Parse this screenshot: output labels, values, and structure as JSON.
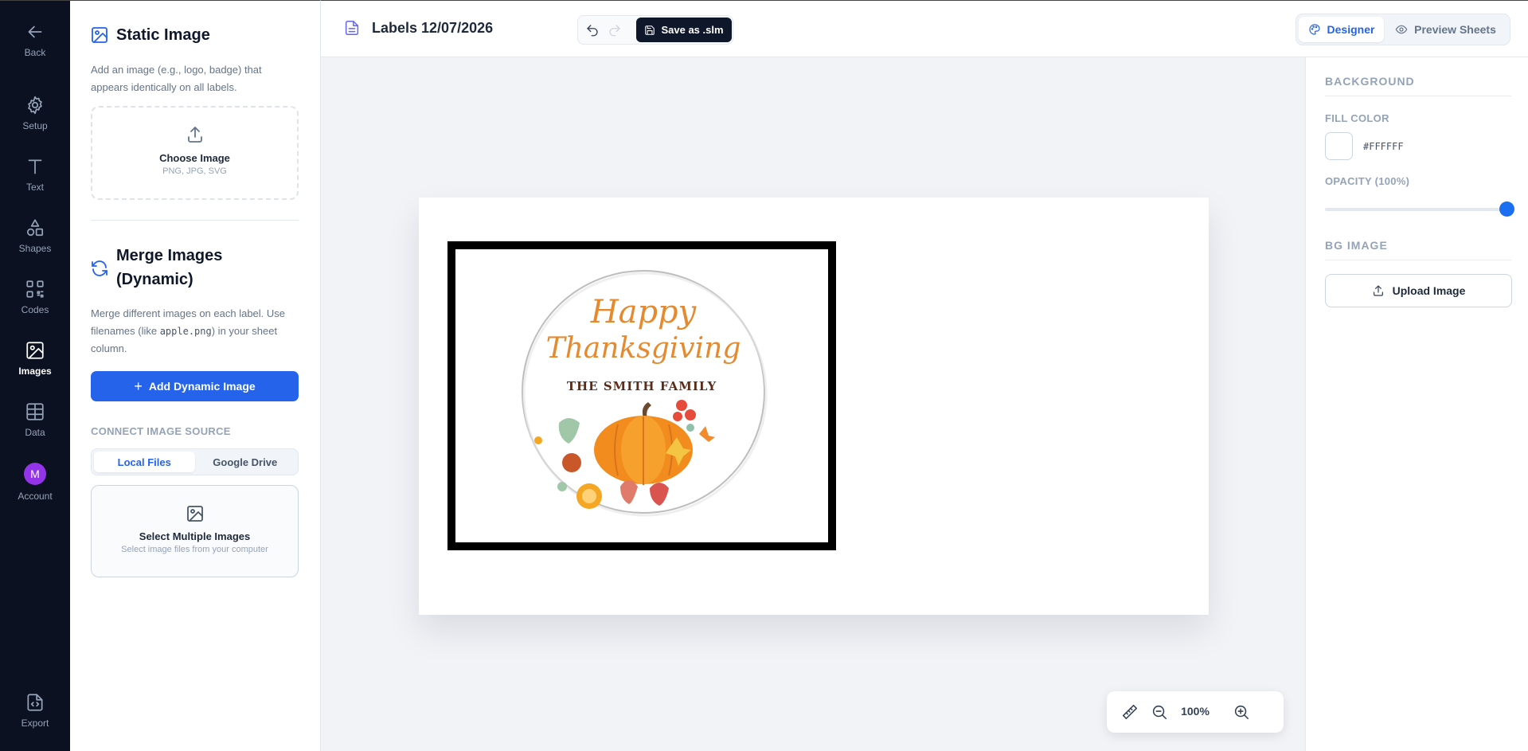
{
  "nav": {
    "back": "Back",
    "setup": "Setup",
    "text": "Text",
    "shapes": "Shapes",
    "codes": "Codes",
    "images": "Images",
    "data": "Data",
    "account": "Account",
    "account_initial": "M",
    "export": "Export"
  },
  "static_image": {
    "title": "Static Image",
    "description": "Add an image (e.g., logo, badge) that appears identically on all labels.",
    "choose_title": "Choose Image",
    "choose_sub": "PNG, JPG, SVG"
  },
  "merge_images": {
    "title": "Merge Images (Dynamic)",
    "desc_part1": "Merge different images on each label. Use filenames (like ",
    "desc_code": "apple.png",
    "desc_part2": ") in your sheet column.",
    "add_button": "Add Dynamic Image",
    "source_label": "CONNECT IMAGE SOURCE",
    "tabs": [
      "Local Files",
      "Google Drive"
    ],
    "active_tab": "Local Files",
    "select_title": "Select Multiple Images",
    "select_sub": "Select image files from your computer"
  },
  "header": {
    "doc_title": "Labels 12/07/2026",
    "save_label": "Save as .slm",
    "modes": [
      "Designer",
      "Preview Sheets"
    ],
    "active_mode": "Designer"
  },
  "canvas": {
    "artwork": {
      "line1": "Happy",
      "line2": "Thanksgiving",
      "line3": "THE SMITH FAMILY"
    },
    "zoom": "100%"
  },
  "properties": {
    "background_title": "BACKGROUND",
    "fill_color_label": "FILL COLOR",
    "fill_color_value": "#FFFFFF",
    "opacity_label": "OPACITY (100%)",
    "opacity_value": 1.0,
    "bg_image_title": "BG IMAGE",
    "upload_label": "Upload Image"
  },
  "colors": {
    "accent": "#2563eb",
    "rail_bg": "#0b1120",
    "avatar": "#9333ea",
    "save_bg": "#0f172a"
  }
}
